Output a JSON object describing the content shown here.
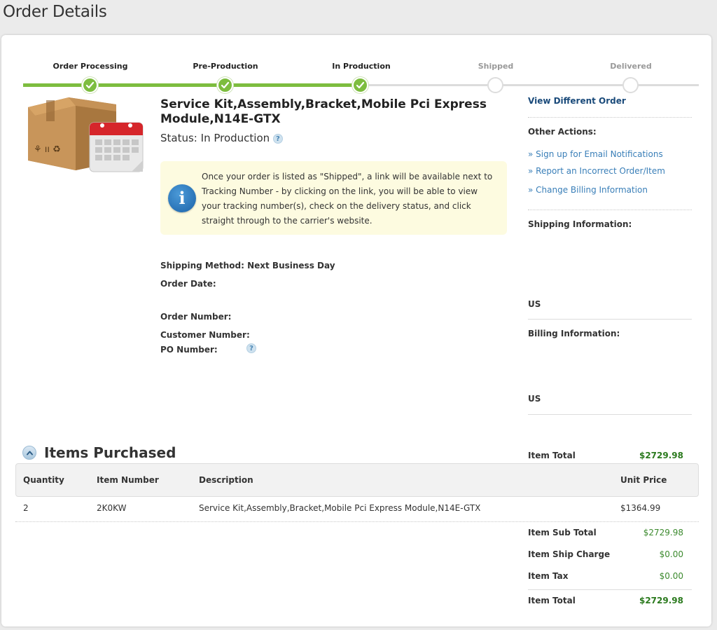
{
  "page": {
    "title": "Order Details"
  },
  "progress": {
    "steps": [
      {
        "label": "Order Processing",
        "state": "done"
      },
      {
        "label": "Pre-Production",
        "state": "done"
      },
      {
        "label": "In Production",
        "state": "done"
      },
      {
        "label": "Shipped",
        "state": "pending"
      },
      {
        "label": "Delivered",
        "state": "pending"
      }
    ],
    "colors": {
      "done": "#7dbd3f",
      "pending": "#dcdcdc"
    }
  },
  "product": {
    "title": "Service Kit,Assembly,Bracket,Mobile Pci Express Module,N14E-GTX",
    "status_label": "Status:",
    "status_value": "In Production",
    "help_glyph": "?"
  },
  "info": {
    "icon_glyph": "i",
    "text": "Once your order is listed as \"Shipped\", a link will be available next to Tracking Number - by clicking on the link, you will be able to view your tracking number(s), check on the delivery status, and click straight through to the carrier's website."
  },
  "order": {
    "shipping_method_label": "Shipping Method:",
    "shipping_method_value": "Next Business Day",
    "order_date_label": "Order Date:",
    "order_number_label": "Order Number:",
    "customer_number_label": "Customer Number:",
    "po_number_label": "PO Number:"
  },
  "sidebar": {
    "view_different_order": "View Different Order",
    "other_actions_label": "Other Actions:",
    "links": [
      "» Sign up for Email Notifications",
      "» Report an Incorrect Order/Item",
      "» Change Billing Information"
    ],
    "shipping_info_label": "Shipping Information:",
    "shipping_country": "US",
    "billing_info_label": "Billing Information:",
    "billing_country": "US"
  },
  "items": {
    "title": "Items Purchased",
    "item_total_label": "Item Total",
    "item_total_value": "$2729.98",
    "columns": [
      "Quantity",
      "Item Number",
      "Description",
      "Unit Price"
    ],
    "rows": [
      {
        "quantity": "2",
        "item_number": "2K0KW",
        "description": "Service Kit,Assembly,Bracket,Mobile Pci Express Module,N14E-GTX",
        "unit_price": "$1364.99"
      }
    ]
  },
  "totals": {
    "sub_total_label": "Item Sub Total",
    "sub_total_value": "$2729.98",
    "ship_charge_label": "Item Ship Charge",
    "ship_charge_value": "$0.00",
    "tax_label": "Item Tax",
    "tax_value": "$0.00",
    "total_label": "Item Total",
    "total_value": "$2729.98"
  }
}
